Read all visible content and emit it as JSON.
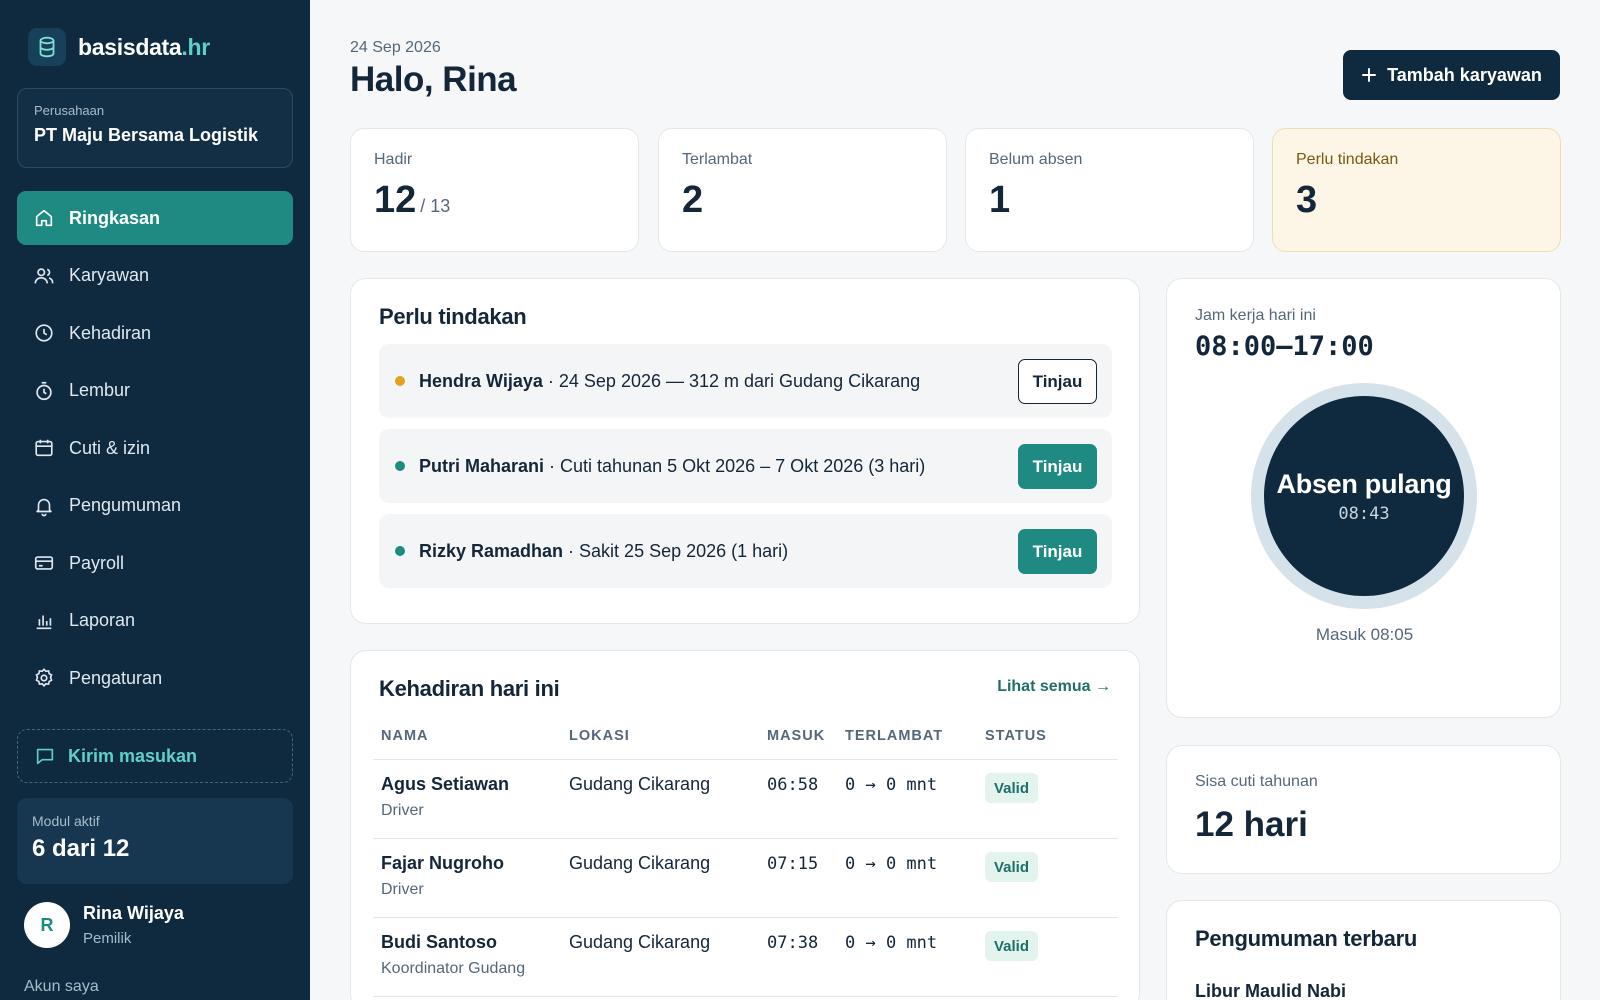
{
  "brand": {
    "name": "basisdata",
    "tld": ".hr"
  },
  "company": {
    "label": "Perusahaan",
    "name": "PT Maju Bersama Logistik"
  },
  "nav": [
    {
      "label": "Ringkasan",
      "icon": "home-icon",
      "active": true
    },
    {
      "label": "Karyawan",
      "icon": "users-icon"
    },
    {
      "label": "Kehadiran",
      "icon": "clock-icon"
    },
    {
      "label": "Lembur",
      "icon": "stopwatch-icon"
    },
    {
      "label": "Cuti & izin",
      "icon": "calendar-icon"
    },
    {
      "label": "Pengumuman",
      "icon": "bell-icon"
    },
    {
      "label": "Payroll",
      "icon": "card-icon"
    },
    {
      "label": "Laporan",
      "icon": "bar-chart-icon"
    },
    {
      "label": "Pengaturan",
      "icon": "gear-icon"
    }
  ],
  "feedback": {
    "label": "Kirim masukan"
  },
  "module": {
    "label": "Modul aktif",
    "value": "6 dari 12"
  },
  "user": {
    "initial": "R",
    "name": "Rina Wijaya",
    "role": "Pemilik",
    "account_label": "Akun saya"
  },
  "header": {
    "date": "24 Sep 2026",
    "greeting": "Halo, Rina",
    "add_button": "Tambah karyawan"
  },
  "stats": [
    {
      "label": "Hadir",
      "value": "12",
      "denominator": "/ 13"
    },
    {
      "label": "Terlambat",
      "value": "2"
    },
    {
      "label": "Belum absen",
      "value": "1"
    },
    {
      "label": "Perlu tindakan",
      "value": "3"
    }
  ],
  "actions": {
    "title": "Perlu tindakan",
    "items": [
      {
        "name": "Hendra Wijaya",
        "detail": " · 24 Sep 2026 — 312 m dari Gudang Cikarang",
        "button": "Tinjau",
        "dot_color": "#e0a020"
      },
      {
        "name": "Putri Maharani",
        "detail": " · Cuti tahunan 5 Okt 2026 – 7 Okt 2026 (3 hari)",
        "button": "Tinjau",
        "dot_color": "#1f8a82"
      },
      {
        "name": "Rizky Ramadhan",
        "detail": " · Sakit 25 Sep 2026 (1 hari)",
        "button": "Tinjau",
        "dot_color": "#1f8a82"
      }
    ]
  },
  "attendance": {
    "title": "Kehadiran hari ini",
    "see_all": "Lihat semua →",
    "columns": [
      "NAMA",
      "LOKASI",
      "MASUK",
      "TERLAMBAT",
      "STATUS"
    ],
    "rows": [
      {
        "name": "Agus Setiawan",
        "job": "Driver",
        "location": "Gudang Cikarang",
        "in": "06:58",
        "late": "0 → 0 mnt",
        "status": "Valid"
      },
      {
        "name": "Fajar Nugroho",
        "job": "Driver",
        "location": "Gudang Cikarang",
        "in": "07:15",
        "late": "0 → 0 mnt",
        "status": "Valid"
      },
      {
        "name": "Budi Santoso",
        "job": "Koordinator Gudang",
        "location": "Gudang Cikarang",
        "in": "07:38",
        "late": "0 → 0 mnt",
        "status": "Valid"
      }
    ]
  },
  "clock": {
    "label": "Jam kerja hari ini",
    "hours": "08:00–17:00",
    "button": "Absen pulang",
    "time": "08:43",
    "checked_in": "Masuk 08:05"
  },
  "leave": {
    "label": "Sisa cuti tahunan",
    "value": "12 hari"
  },
  "news": {
    "title": "Pengumuman terbaru",
    "first_item": "Libur Maulid Nabi"
  },
  "colors": {
    "sidebar": "#0f2a3e",
    "accent": "#1f8a82",
    "warn_card": "#fdf6e6",
    "valid_badge": "#e3f3ee"
  }
}
